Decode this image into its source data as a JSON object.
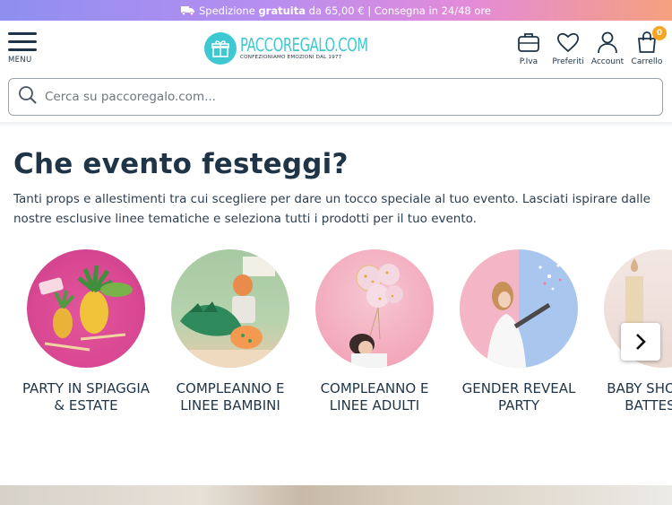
{
  "promo": {
    "text_before": "Spedizione",
    "text_bold": "gratuita",
    "text_after": "da 65,00 € | Consegna in 24/48 ore",
    "colors": [
      "#8e8ff0",
      "#e48bd8",
      "#f5a17e"
    ]
  },
  "header": {
    "menu_label": "MENU",
    "logo_name": "PACCOREGALO.COM",
    "logo_tagline": "CONFEZIONIAMO EMOZIONI DAL 1977",
    "icons": [
      {
        "label": "P.Iva",
        "icon": "briefcase-icon"
      },
      {
        "label": "Preferiti",
        "icon": "heart-icon"
      },
      {
        "label": "Account",
        "icon": "user-icon"
      },
      {
        "label": "Carrello",
        "icon": "bag-icon"
      }
    ],
    "cart_count": "0",
    "accent": "#3ec8d1",
    "badge_color": "#f6a623"
  },
  "search": {
    "placeholder": "Cerca su paccoregalo.com..."
  },
  "main": {
    "title": "Che evento festeggi?",
    "description": "Tanti props e allestimenti tra cui scegliere per dare un tocco speciale al tuo evento. Lasciati ispirare dalle nostre esclusive linee tematiche e seleziona tutti i prodotti per il tuo evento.",
    "categories": [
      {
        "label": "PARTY IN SPIAGGIA & ESTATE"
      },
      {
        "label": "COMPLEANNO E LINEE BAMBINI"
      },
      {
        "label": "COMPLEANNO E LINEE ADULTI"
      },
      {
        "label": "GENDER REVEAL PARTY"
      },
      {
        "label": "BABY SHOWER E BATTESIMO"
      }
    ],
    "next_icon": "chevron-right-icon"
  }
}
